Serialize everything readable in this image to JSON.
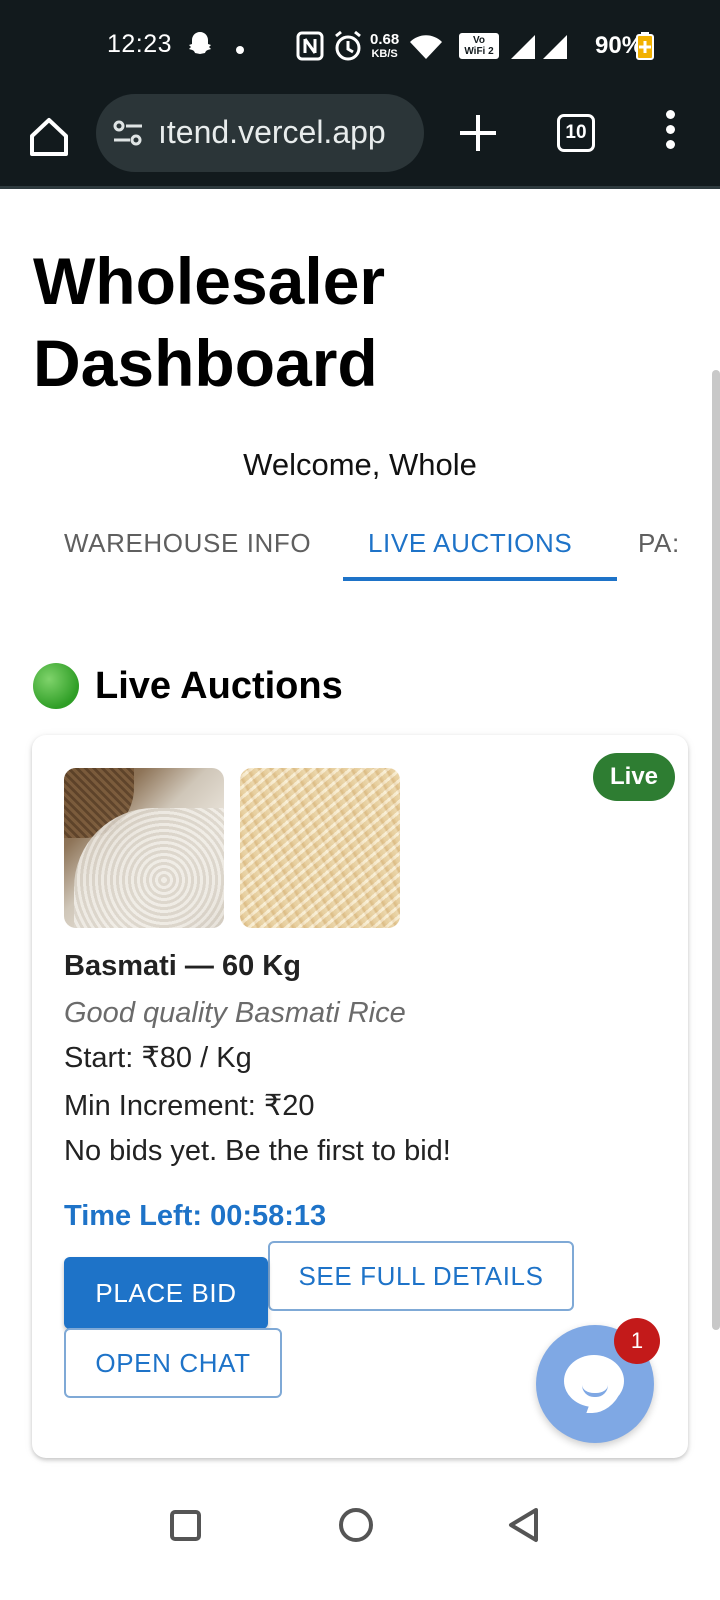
{
  "status_bar": {
    "time": "12:23",
    "network_speed_top": "0.68",
    "network_speed_bottom": "KB/S",
    "wifi_label_top": "Vo",
    "wifi_label_bottom": "WiFi 2",
    "battery": "90%",
    "icons": [
      "snapchat-ghost-icon",
      "dot-icon",
      "nfc-icon",
      "alarm-icon",
      "wifi-icon",
      "signal-icon",
      "signal-icon",
      "battery-icon"
    ]
  },
  "browser": {
    "url": "ıtend.vercel.app",
    "tab_count": "10",
    "icons": [
      "home-icon",
      "site-settings-icon",
      "plus-icon",
      "tabs-icon",
      "more-vert-icon"
    ]
  },
  "page": {
    "title": "Wholesaler Dashboard",
    "welcome": "Welcome, Whole",
    "tabs": [
      {
        "label": "WAREHOUSE INFO",
        "active": false
      },
      {
        "label": "LIVE AUCTIONS",
        "active": true
      },
      {
        "label": "PA:",
        "active": false
      }
    ],
    "section_icon": "green-circle-icon",
    "section_title": "Live Auctions"
  },
  "auction": {
    "status": "Live",
    "status_color": "#2e7d32",
    "images": [
      "rice-sack-image",
      "basmati-grains-image"
    ],
    "name": "Basmati — 60 Kg",
    "description": "Good quality Basmati Rice",
    "start": "Start: ₹80 / Kg",
    "min_increment": "Min Increment: ₹20",
    "bids": "No bids yet. Be the first to bid!",
    "time_left": "Time Left: 00:58:13",
    "place_bid_label": "PLACE BID",
    "details_label": "SEE FULL DETAILS",
    "chat_label": "OPEN CHAT"
  },
  "chat_widget": {
    "badge_count": "1",
    "color": "#7fa8e4"
  },
  "colors": {
    "accent": "#1e73c8",
    "live": "#2e7d32",
    "badge": "#c31a1a"
  }
}
